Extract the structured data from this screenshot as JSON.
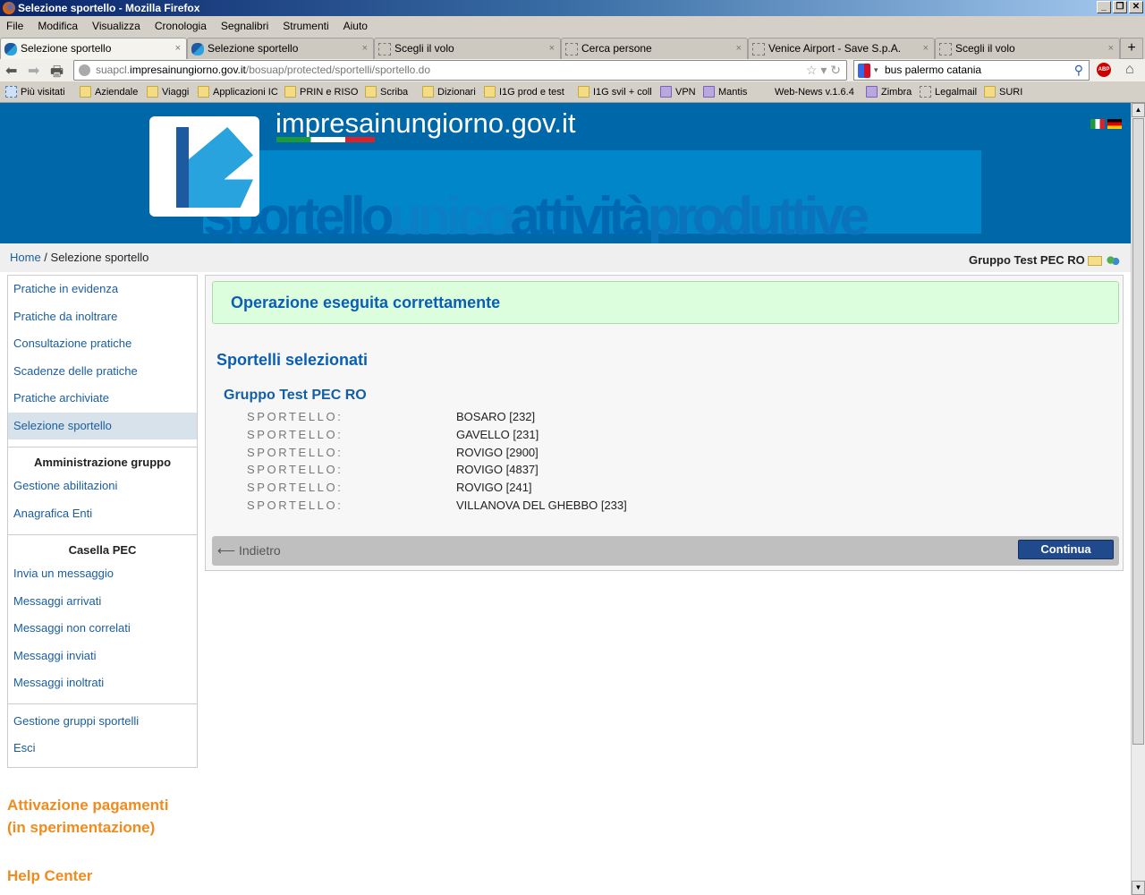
{
  "window": {
    "title": "Selezione sportello - Mozilla Firefox"
  },
  "menu": [
    "File",
    "Modifica",
    "Visualizza",
    "Cronologia",
    "Segnalibri",
    "Strumenti",
    "Aiuto"
  ],
  "tabs": [
    {
      "label": "Selezione sportello",
      "active": true,
      "icon": "site-logo"
    },
    {
      "label": "Selezione sportello",
      "icon": "site-logo"
    },
    {
      "label": "Scegli il volo",
      "icon": "blank-page"
    },
    {
      "label": "Cerca persone",
      "icon": "blank-page"
    },
    {
      "label": "Venice Airport - Save S.p.A.",
      "icon": "blank-page"
    },
    {
      "label": "Scegli il volo",
      "icon": "blank-page"
    }
  ],
  "nav": {
    "url_prefix": "suapcl.",
    "url_domain": "impresainungiorno.gov.it",
    "url_path": "/bosuap/protected/sportelli/sportello.do",
    "search_value": "bus palermo catania"
  },
  "bookmarks": [
    "Più visitati",
    "Aziendale",
    "Viaggi",
    "Applicazioni IC",
    "PRIN e RISO",
    "Scriba",
    "Dizionari",
    "I1G  prod e test",
    "I1G svil + coll",
    "VPN",
    "Mantis",
    "Web-News v.1.6.4",
    "Zimbra",
    "Legalmail",
    "SURI"
  ],
  "banner": {
    "site": "impresainungiorno.gov.it",
    "subtitle": [
      "sportello",
      "unico",
      "attività",
      "produttive"
    ]
  },
  "breadcrumb": {
    "home": "Home",
    "sep": " / ",
    "current": "Selezione sportello"
  },
  "user_group": "Gruppo Test PEC RO",
  "sidebar": {
    "items1": [
      "Pratiche in evidenza",
      "Pratiche da inoltrare",
      "Consultazione pratiche",
      "Scadenze delle pratiche",
      "Pratiche archiviate",
      "Selezione sportello"
    ],
    "selected": "Selezione sportello",
    "admin_heading": "Amministrazione gruppo",
    "items2": [
      "Gestione abilitazioni",
      "Anagrafica Enti"
    ],
    "pec_heading": "Casella PEC",
    "items3": [
      "Invia un messaggio",
      "Messaggi arrivati",
      "Messaggi non correlati",
      "Messaggi inviati",
      "Messaggi inoltrati"
    ],
    "items4": [
      "Gestione gruppi sportelli",
      "Esci"
    ]
  },
  "extra": {
    "payments_1": "Attivazione pagamenti",
    "payments_2": "(in sperimentazione)",
    "help": "Help Center"
  },
  "main": {
    "success": "Operazione eseguita correttamente",
    "title": "Sportelli selezionati",
    "group": "Gruppo Test PEC RO",
    "rows": [
      {
        "k": "SPORTELLO:",
        "v": "BOSARO [232]"
      },
      {
        "k": "SPORTELLO:",
        "v": "GAVELLO [231]"
      },
      {
        "k": "SPORTELLO:",
        "v": "ROVIGO [2900]"
      },
      {
        "k": "SPORTELLO:",
        "v": "ROVIGO [4837]"
      },
      {
        "k": "SPORTELLO:",
        "v": "ROVIGO [241]"
      },
      {
        "k": "SPORTELLO:",
        "v": "VILLANOVA DEL GHEBBO [233]"
      }
    ],
    "back": "⟵ Indietro",
    "continue": "Continua"
  },
  "colors": {
    "banner": "#0067a8",
    "link": "#1a5d9e",
    "heading": "#0a5fb4",
    "accent_orange": "#f08b1e",
    "success_bg": "#ddfedd",
    "button": "#214a8c"
  }
}
